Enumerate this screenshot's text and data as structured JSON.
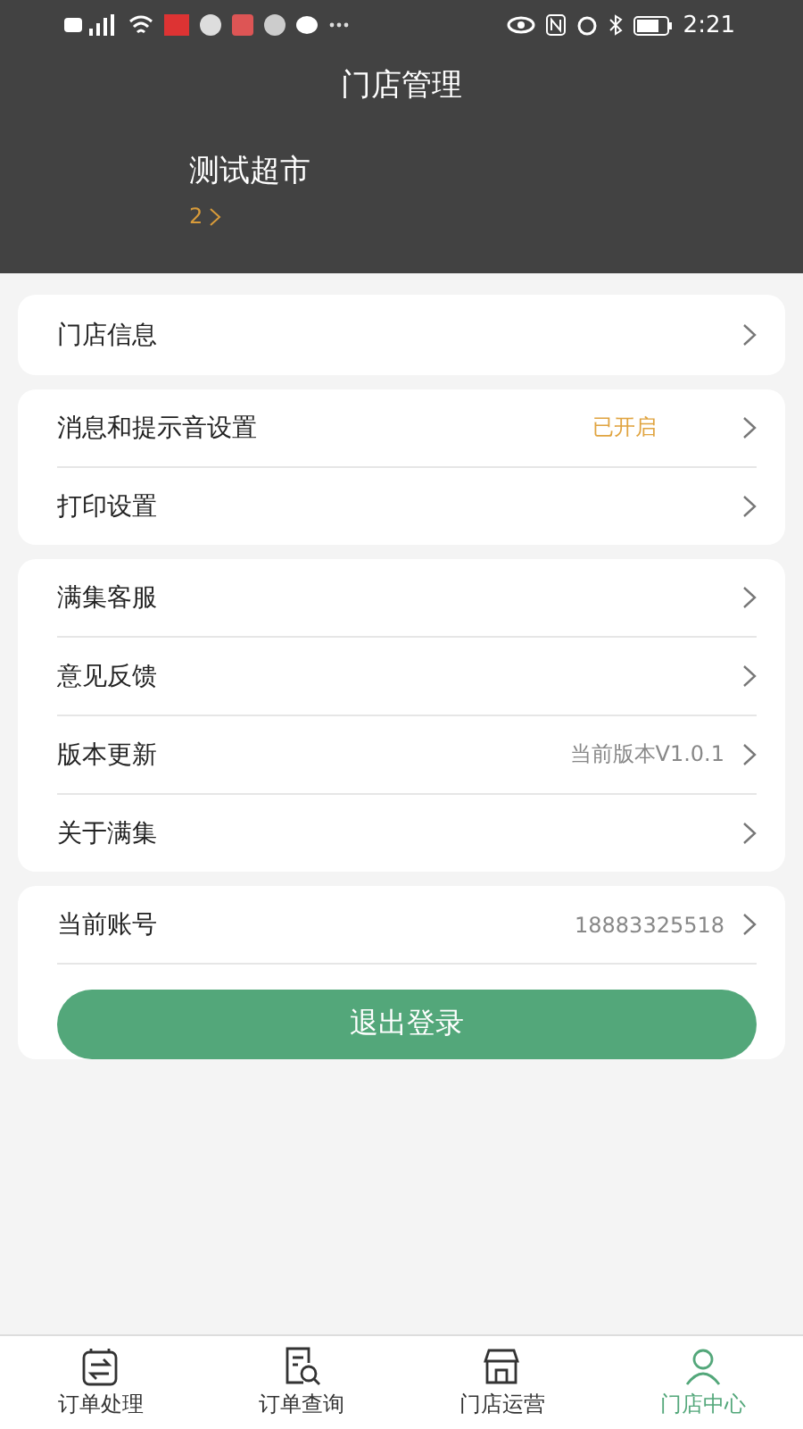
{
  "status_bar": {
    "time": "2:21"
  },
  "header": {
    "title": "门店管理",
    "store_name": "测试超市",
    "store_count": "2"
  },
  "groups": [
    {
      "rows": [
        {
          "label": "门店信息"
        }
      ]
    },
    {
      "rows": [
        {
          "label": "消息和提示音设置",
          "value": "已开启",
          "kind": "status"
        },
        {
          "label": "打印设置"
        }
      ]
    },
    {
      "rows": [
        {
          "label": "满集客服"
        },
        {
          "label": "意见反馈"
        },
        {
          "label": "版本更新",
          "value": "当前版本V1.0.1",
          "kind": "info"
        },
        {
          "label": "关于满集"
        }
      ]
    },
    {
      "rows": [
        {
          "label": "当前账号",
          "value": "18883325518",
          "kind": "info"
        }
      ],
      "button": "退出登录"
    }
  ],
  "tabs": [
    {
      "label": "订单处理",
      "kind": "swap",
      "selected": false
    },
    {
      "label": "订单查询",
      "kind": "search",
      "selected": false
    },
    {
      "label": "门店运营",
      "kind": "store",
      "selected": false
    },
    {
      "label": "门店中心",
      "kind": "person",
      "selected": true
    }
  ]
}
